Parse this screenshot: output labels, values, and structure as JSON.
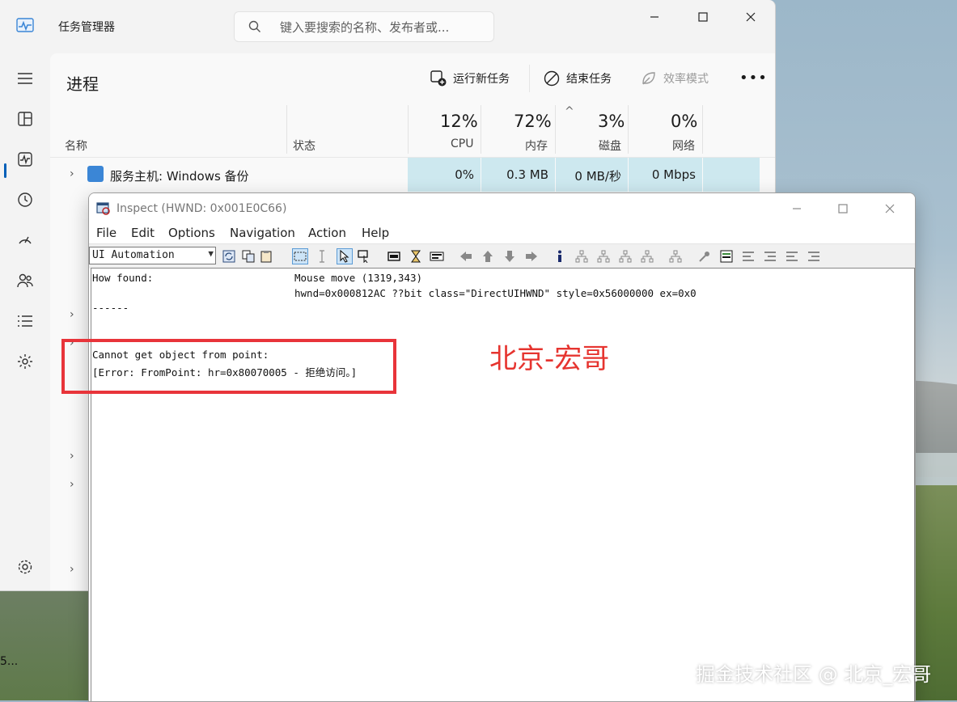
{
  "task_manager": {
    "title": "任务管理器",
    "search_placeholder": "键入要搜索的名称、发布者或...",
    "page_heading": "进程",
    "toolbar": {
      "run_new_task": "运行新任务",
      "end_task": "结束任务",
      "efficiency_mode": "效率模式",
      "more": "•••"
    },
    "columns": {
      "name": "名称",
      "status": "状态",
      "cpu_pct": "12%",
      "cpu_label": "CPU",
      "mem_pct": "72%",
      "mem_label": "内存",
      "disk_pct": "3%",
      "disk_label": "磁盘",
      "net_pct": "0%",
      "net_label": "网络"
    },
    "process_row": {
      "name": "服务主机: Windows 备份",
      "cpu": "0%",
      "memory": "0.3 MB",
      "disk": "0 MB/秒",
      "network": "0 Mbps"
    },
    "sidebar_icons": [
      "menu-icon",
      "processes-icon",
      "performance-icon",
      "app-history-icon",
      "startup-icon",
      "users-icon",
      "details-icon",
      "services-icon",
      "settings-icon"
    ],
    "accent_color": "#005fb8",
    "highlight_color": "#cde8ef"
  },
  "inspect": {
    "title": "Inspect  (HWND: 0x001E0C66)",
    "menu": [
      "File",
      "Edit",
      "Options",
      "Navigation",
      "Action",
      "Help"
    ],
    "mode_select": "UI Automation",
    "body": {
      "how_found_label": "How found:",
      "how_found_value1": "Mouse move (1319,343)",
      "how_found_value2": "hwnd=0x000812AC ??bit class=\"DirectUIHWND\" style=0x56000000 ex=0x0",
      "separator": "------",
      "error_line1": "Cannot get object from point:",
      "error_line2": "[Error: FromPoint: hr=0x80070005 - 拒绝访问。]"
    }
  },
  "overlay_text": "北京-宏哥",
  "watermark": "掘金技术社区 @ 北京_宏哥",
  "edge_text": "5...",
  "annotation_color": "#e8343a"
}
